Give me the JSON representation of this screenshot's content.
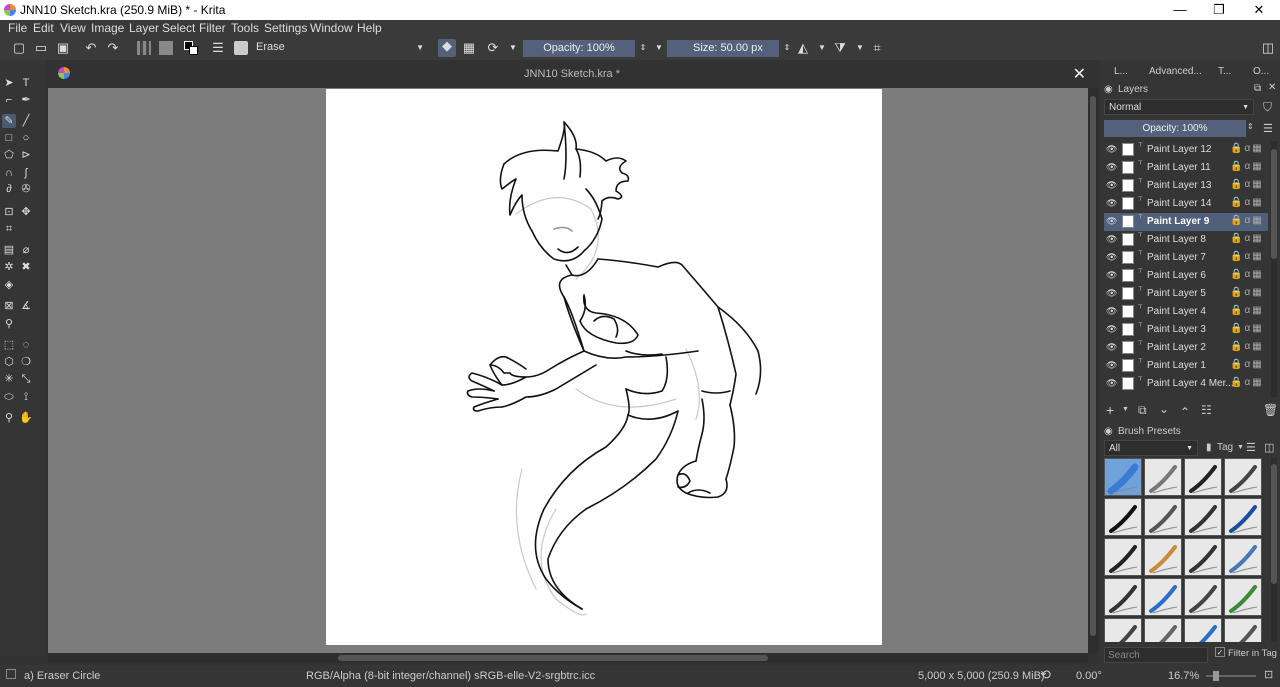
{
  "window": {
    "title": "JNN10 Sketch.kra (250.9 MiB)  * - Krita",
    "controls": [
      "—",
      "❐",
      "✕"
    ]
  },
  "menu": [
    "File",
    "Edit",
    "View",
    "Image",
    "Layer",
    "Select",
    "Filter",
    "Tools",
    "Settings",
    "Window",
    "Help"
  ],
  "toolbar": {
    "brush_preset": "Erase",
    "opacity": "Opacity: 100%",
    "size_label": "Size:",
    "size_value": "50.00 px"
  },
  "document": {
    "tab_title": "JNN10 Sketch.kra *"
  },
  "dock": {
    "tabs": [
      "L...",
      "Advanced...",
      "T...",
      "O..."
    ],
    "layers_title": "Layers",
    "blend_mode": "Normal",
    "opacity": "Opacity:  100%",
    "layers": [
      {
        "name": "Paint Layer 12",
        "selected": false
      },
      {
        "name": "Paint Layer 11",
        "selected": false
      },
      {
        "name": "Paint Layer 13",
        "selected": false
      },
      {
        "name": "Paint Layer 14",
        "selected": false
      },
      {
        "name": "Paint Layer 9",
        "selected": true
      },
      {
        "name": "Paint Layer 8",
        "selected": false
      },
      {
        "name": "Paint Layer 7",
        "selected": false
      },
      {
        "name": "Paint Layer 6",
        "selected": false
      },
      {
        "name": "Paint Layer 5",
        "selected": false
      },
      {
        "name": "Paint Layer 4",
        "selected": false
      },
      {
        "name": "Paint Layer 3",
        "selected": false
      },
      {
        "name": "Paint Layer 2",
        "selected": false
      },
      {
        "name": "Paint Layer 1",
        "selected": false
      },
      {
        "name": "Paint Layer 4 Mer...",
        "selected": false
      }
    ],
    "brush_presets_title": "Brush Presets",
    "tag_filter": "All",
    "tag_label": "Tag",
    "search_placeholder": "Search",
    "filter_in_tag": "Filter in Tag"
  },
  "status": {
    "tool": "a) Eraser Circle",
    "color_profile": "RGB/Alpha (8-bit integer/channel)  sRGB-elle-V2-srgbtrc.icc",
    "image_size": "5,000 x 5,000 (250.9 MiB)",
    "rotation": "0.00°",
    "zoom": "16.7%"
  },
  "colors": {
    "accent": "#50607a",
    "canvas_bg": "#7c7c7c",
    "ui_bg": "#353535"
  }
}
